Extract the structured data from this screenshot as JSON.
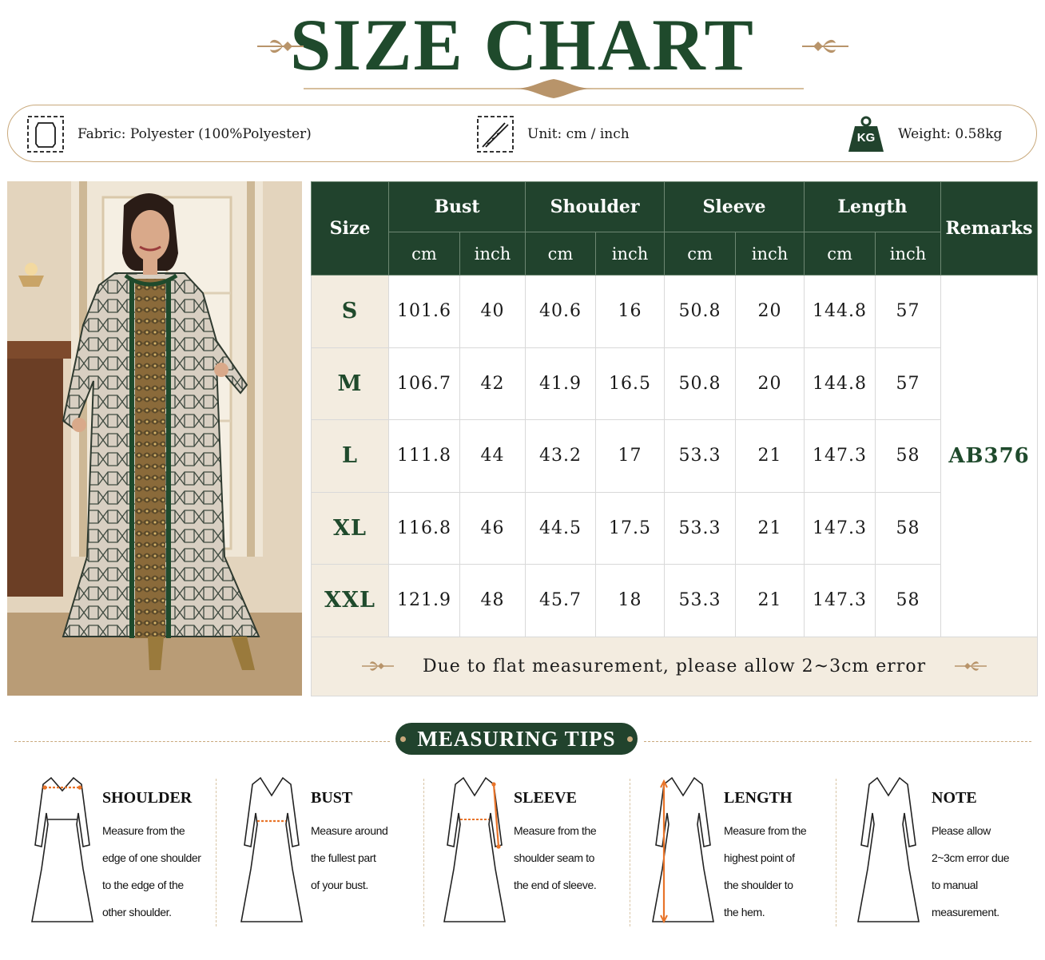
{
  "title": "SIZE CHART",
  "info": {
    "fabric": "Fabric: Polyester (100%Polyester)",
    "unit": "Unit: cm / inch",
    "weight_icon_label": "KG",
    "weight": "Weight: 0.58kg",
    "icons": [
      "fabric-icon",
      "tape-measure-icon",
      "weight-icon"
    ]
  },
  "table": {
    "size_header": "Size",
    "groups": [
      "Bust",
      "Shoulder",
      "Sleeve",
      "Length"
    ],
    "units": [
      "cm",
      "inch",
      "cm",
      "inch",
      "cm",
      "inch",
      "cm",
      "inch"
    ],
    "remarks_header": "Remarks",
    "rows": [
      {
        "size": "S",
        "values": [
          "101.6",
          "40",
          "40.6",
          "16",
          "50.8",
          "20",
          "144.8",
          "57"
        ]
      },
      {
        "size": "M",
        "values": [
          "106.7",
          "42",
          "41.9",
          "16.5",
          "50.8",
          "20",
          "144.8",
          "57"
        ]
      },
      {
        "size": "L",
        "values": [
          "111.8",
          "44",
          "43.2",
          "17",
          "53.3",
          "21",
          "147.3",
          "58"
        ]
      },
      {
        "size": "XL",
        "values": [
          "116.8",
          "46",
          "44.5",
          "17.5",
          "53.3",
          "21",
          "147.3",
          "58"
        ]
      },
      {
        "size": "XXL",
        "values": [
          "121.9",
          "48",
          "45.7",
          "18",
          "53.3",
          "21",
          "147.3",
          "58"
        ]
      }
    ],
    "remark": "AB376",
    "note": "Due to flat measurement, please allow 2~3cm error"
  },
  "tips": {
    "heading": "MEASURING TIPS",
    "items": [
      {
        "title": "SHOULDER",
        "lines": [
          "Measure from the",
          "edge of one shoulder",
          "to the edge of the",
          "other shoulder."
        ]
      },
      {
        "title": "BUST",
        "lines": [
          "Measure around",
          "the fullest part",
          "of your bust."
        ]
      },
      {
        "title": "SLEEVE",
        "lines": [
          "Measure from the",
          "shoulder seam to",
          "the end of sleeve."
        ]
      },
      {
        "title": "LENGTH",
        "lines": [
          "Measure from the",
          "highest point of",
          "the shoulder to",
          "the hem."
        ]
      },
      {
        "title": "NOTE",
        "lines": [
          "Please allow",
          "2~3cm error due",
          "to manual",
          "measurement."
        ]
      }
    ]
  },
  "colors": {
    "brand_green": "#21432d",
    "gold_accent": "#c9a97c",
    "cream": "#f3ece0",
    "measure_orange": "#e8742a"
  }
}
